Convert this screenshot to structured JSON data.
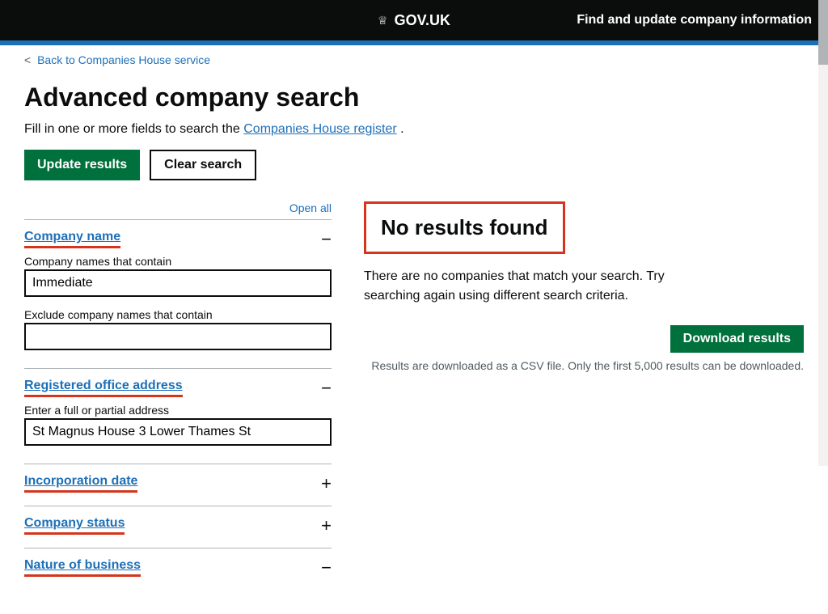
{
  "header": {
    "logo_crown": "♛",
    "logo_text": "GOV.UK",
    "title": "Find and update company information"
  },
  "breadcrumb": {
    "back_label": "Back to Companies House service",
    "back_href": "#"
  },
  "page": {
    "title": "Advanced company search",
    "subtitle_prefix": "Fill in one or more fields to search the",
    "subtitle_link": "Companies House register",
    "subtitle_suffix": "."
  },
  "toolbar": {
    "update_label": "Update results",
    "clear_label": "Clear search"
  },
  "filters": {
    "open_all_label": "Open all",
    "company_name_section": {
      "title": "Company name",
      "toggle": "−",
      "contains_label": "Company names that contain",
      "contains_value": "Immediate",
      "exclude_label": "Exclude company names that contain",
      "exclude_value": ""
    },
    "registered_office_section": {
      "title": "Registered office address",
      "toggle": "−",
      "address_label": "Enter a full or partial address",
      "address_value": "St Magnus House 3 Lower Thames St"
    },
    "incorporation_date_section": {
      "title": "Incorporation date",
      "toggle": "+"
    },
    "company_status_section": {
      "title": "Company status",
      "toggle": "+"
    },
    "nature_of_business_section": {
      "title": "Nature of business",
      "toggle": "−"
    }
  },
  "results": {
    "no_results_title": "No results found",
    "no_results_desc": "There are no companies that match your search. Try searching again using different search criteria.",
    "download_label": "Download results",
    "download_note": "Results are downloaded as a CSV file. Only the first 5,000 results can be downloaded."
  },
  "colors": {
    "green": "#00703c",
    "red": "#d4351c",
    "blue": "#1d70b8",
    "black": "#0b0c0c"
  }
}
